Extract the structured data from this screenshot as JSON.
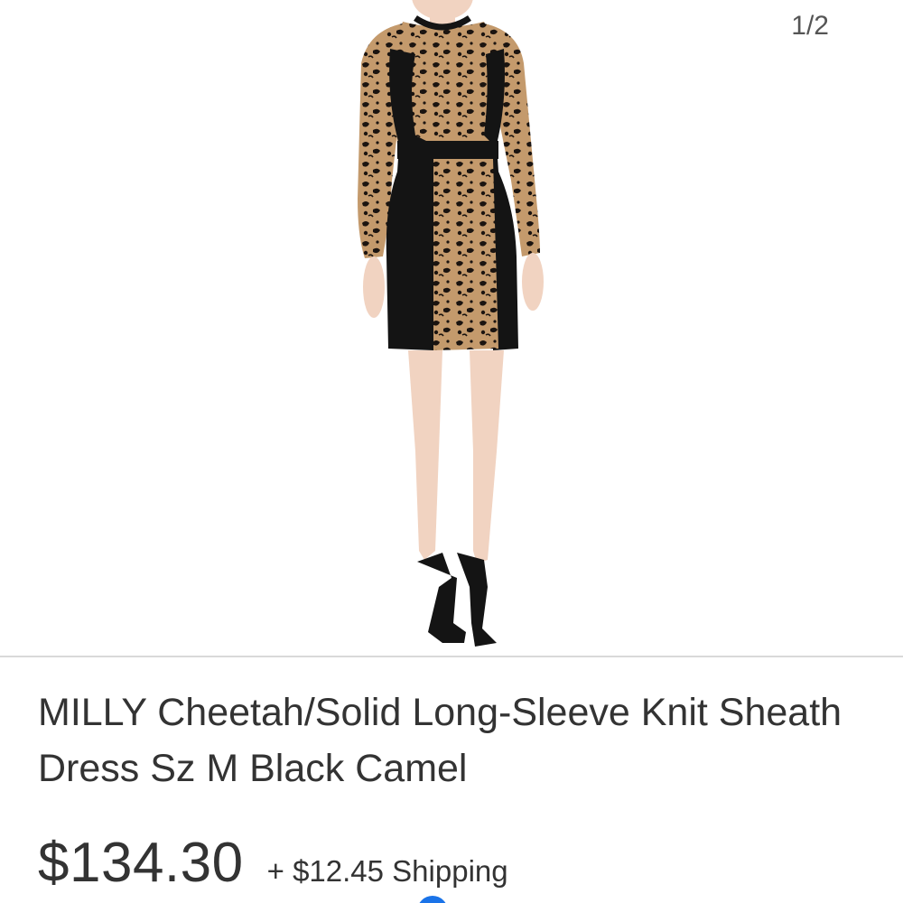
{
  "gallery": {
    "counter": "1/2",
    "image": {
      "icon": "product-photo-dress",
      "description_colors": {
        "black": "#141414",
        "camel": "#c49a6c",
        "skin": "#f1d3c1"
      }
    }
  },
  "listing": {
    "title": "MILLY Cheetah/Solid Long-Sleeve Knit Sheath Dress Sz M Black Camel",
    "price": "$134.30",
    "shipping": "+ $12.45 Shipping"
  },
  "colors": {
    "accent": "#1a73e8",
    "text": "#333333",
    "divider": "#d9d9d9"
  }
}
